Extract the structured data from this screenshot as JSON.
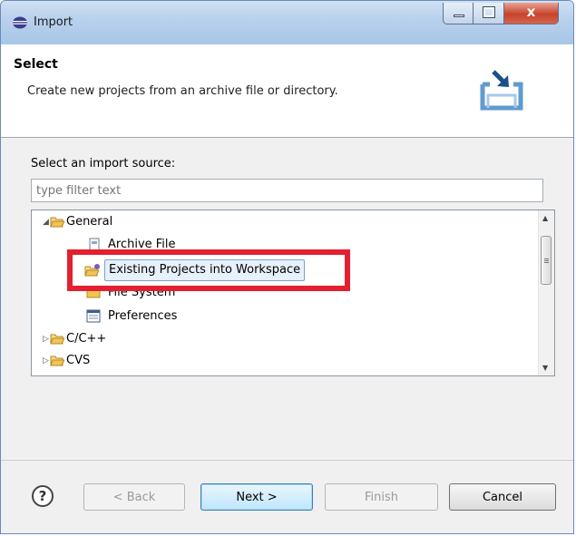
{
  "window": {
    "title": "Import",
    "close_glyph": "x"
  },
  "header": {
    "title": "Select",
    "description": "Create new projects from an archive file or directory.",
    "icon": "import-wizard-icon"
  },
  "source": {
    "label": "Select an import source:",
    "filter_placeholder": "type filter text"
  },
  "tree": {
    "general": "General",
    "archive_file": "Archive File",
    "existing_projects": "Existing Projects into Workspace",
    "file_system": "File System",
    "preferences": "Preferences",
    "cpp": "C/C++",
    "cvs": "CVS"
  },
  "buttons": {
    "help": "?",
    "back": "< Back",
    "next": "Next >",
    "finish": "Finish",
    "cancel": "Cancel"
  },
  "colors": {
    "highlight": "#e3202f",
    "folder": "#f2c451",
    "selection": "#e7f0fb"
  }
}
